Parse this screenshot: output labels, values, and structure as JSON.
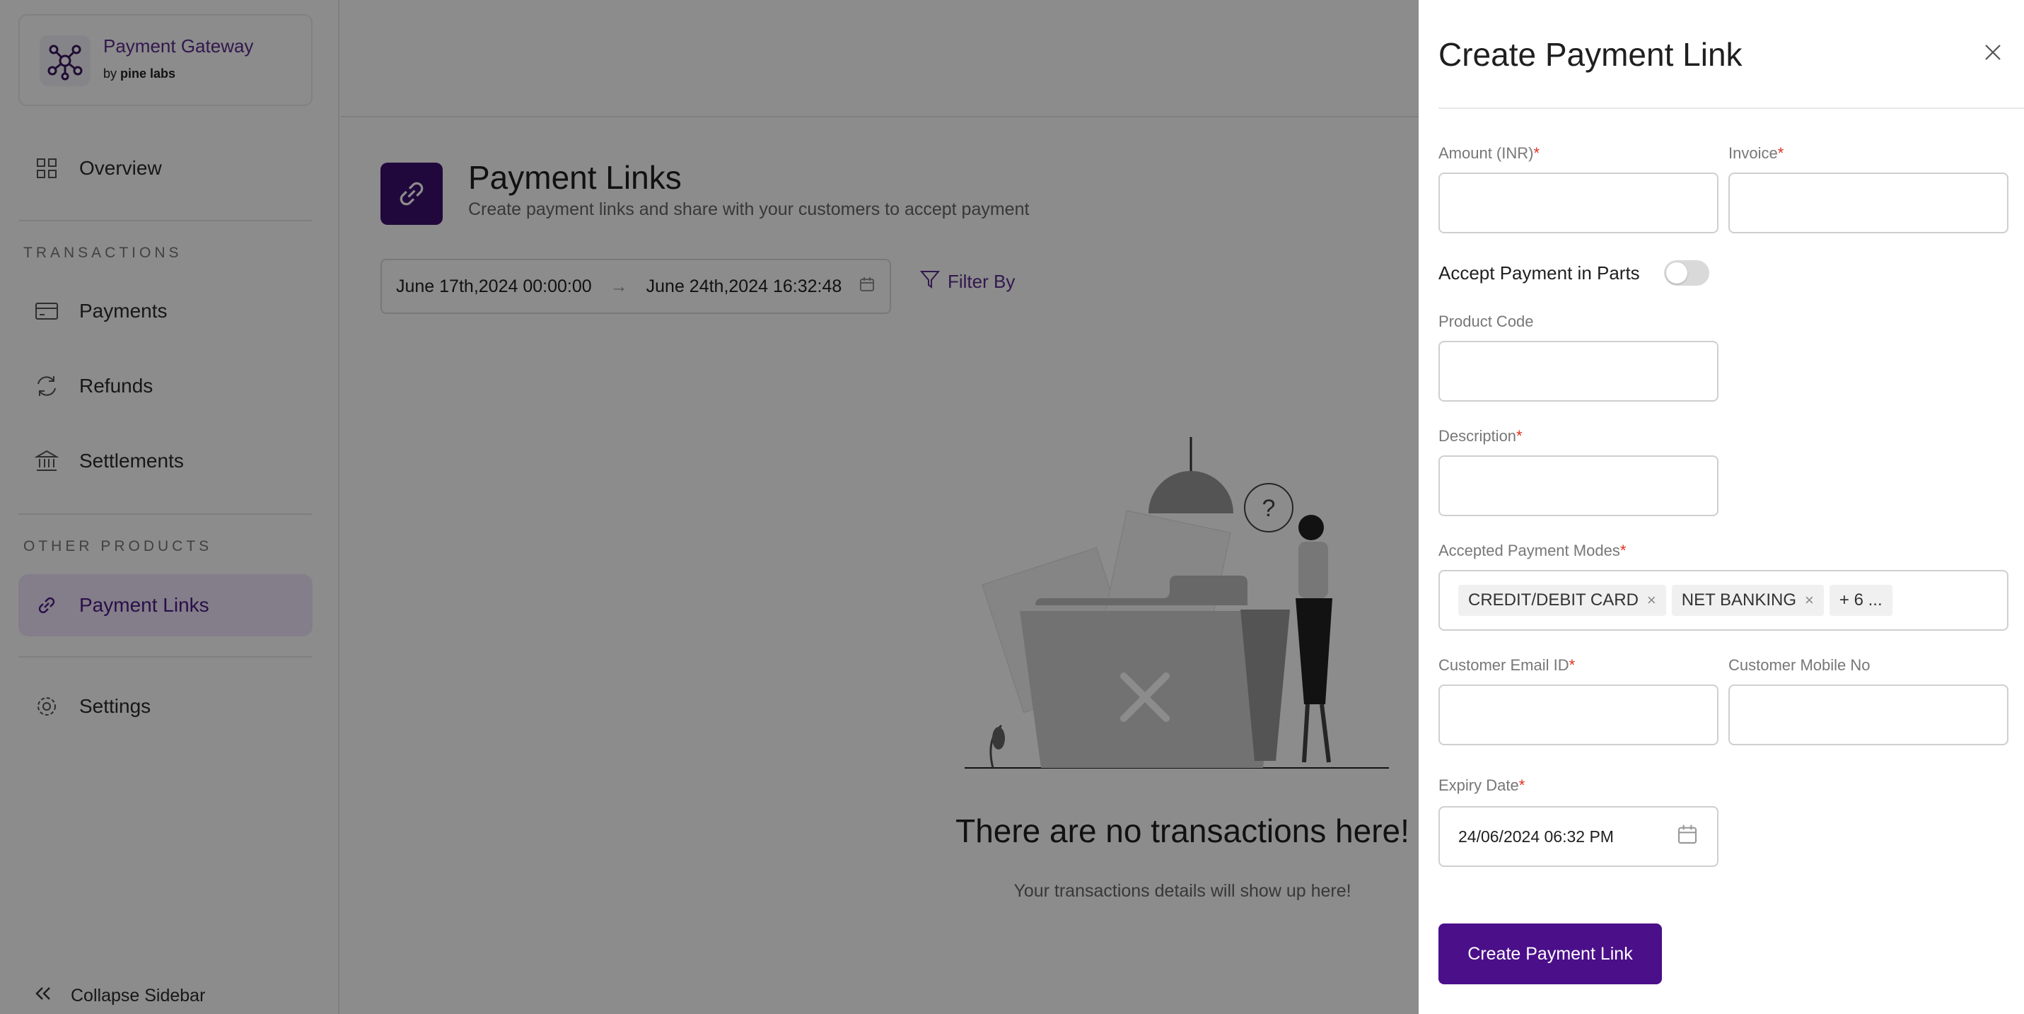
{
  "brand": {
    "title": "Payment Gateway",
    "by": "by",
    "company": "pine labs"
  },
  "sidebar": {
    "overview": "Overview",
    "section_transactions": "TRANSACTIONS",
    "payments": "Payments",
    "refunds": "Refunds",
    "settlements": "Settlements",
    "section_other": "OTHER PRODUCTS",
    "payment_links": "Payment Links",
    "settings": "Settings",
    "collapse": "Collapse Sidebar",
    "active_item": "Payment Links"
  },
  "page": {
    "title": "Payment Links",
    "subtitle": "Create payment links and share with your customers to accept payment",
    "date_from": "June 17th,2024 00:00:00",
    "date_arrow": "→",
    "date_to": "June 24th,2024 16:32:48",
    "filter_label": "Filter By",
    "empty_title": "There are no transactions here!",
    "empty_subtitle": "Your transactions details will show up here!"
  },
  "drawer": {
    "title": "Create Payment Link",
    "required_mark": "*",
    "amount_label": "Amount (INR)",
    "invoice_label": "Invoice",
    "parts_label": "Accept Payment in Parts",
    "parts_enabled": false,
    "product_code_label": "Product Code",
    "description_label": "Description",
    "modes_label": "Accepted Payment Modes",
    "modes": [
      "CREDIT/DEBIT CARD",
      "NET BANKING"
    ],
    "modes_more": "+ 6 ...",
    "tag_remove": "×",
    "email_label": "Customer Email ID",
    "mobile_label": "Customer Mobile No",
    "expiry_label": "Expiry Date",
    "expiry_value": "24/06/2024 06:32 PM",
    "submit": "Create Payment Link"
  },
  "colors": {
    "brand": "#4b0f8a",
    "accent": "#5b2d8e",
    "required": "#e0301e",
    "overlay": "rgba(0,0,0,0.45)"
  },
  "icons": [
    "hub-logo-icon",
    "grid-icon",
    "card-icon",
    "refresh-icon",
    "bank-icon",
    "link-icon",
    "gear-icon",
    "chevrons-left-icon",
    "calendar-icon",
    "filter-icon",
    "close-icon"
  ]
}
